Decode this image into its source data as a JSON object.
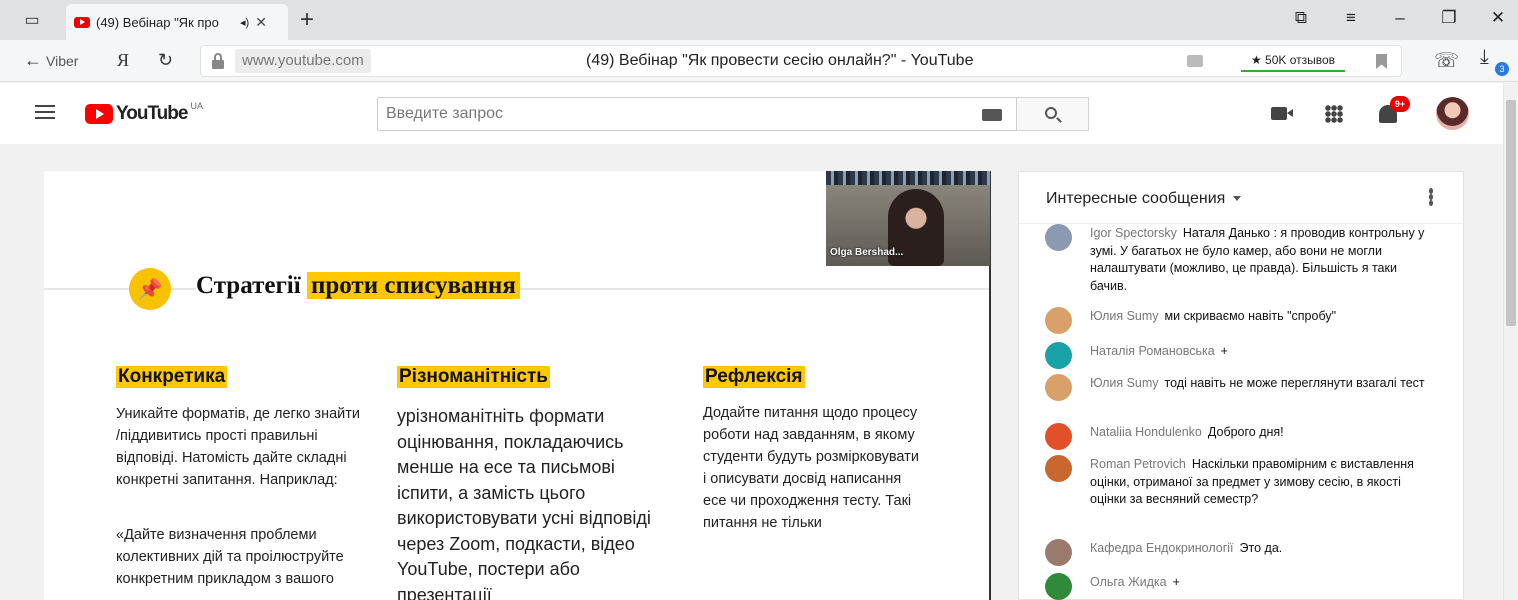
{
  "browser": {
    "tab_title": "(49) Вебінар \"Як про",
    "audio_icon": "speaker-icon",
    "new_tab": "+",
    "back_label": "Viber",
    "yandex_label": "Я",
    "url_domain": "www.youtube.com",
    "page_title": "(49) Вебінар \"Як провести сесію онлайн?\" - YouTube",
    "reviews_badge": "★ 50K отзывов",
    "download_count": "3"
  },
  "youtube": {
    "logo_text": "YouTube",
    "region": "UA",
    "search_placeholder": "Введите запрос",
    "notifications_badge": "9+"
  },
  "slide": {
    "heading_plain": "Стратегії",
    "heading_highlight": "проти списування",
    "col1": {
      "title": "Конкретика",
      "text": "Уникайте форматів, де легко знайти /піддивитись прості правильні відповіді. Натомість дайте складні конкретні запитання. Наприклад:",
      "quote": "«Дайте визначення проблеми колективних дій та проілюструйте конкретним прикладом з вашого"
    },
    "col2": {
      "title": "Різноманітність",
      "text": "урізноманітніть формати оцінювання, покладаючись менше на есе та письмові іспити, а замість цього використовувати усні відповіді через Zoom, подкасти, відео YouTube, постери або презентації"
    },
    "col3": {
      "title": "Рефлексія",
      "text": "Додайте питання щодо процесу роботи над завданням, в якому студенти будуть розмірковувати і описувати досвід написання есе чи проходження тесту. Такі питання не тільки"
    },
    "webcam_name": "Olga Bershad..."
  },
  "chat": {
    "mode": "Интересные сообщения",
    "messages": [
      {
        "author": "Igor Spectorsky",
        "text": "Наталя Данько : я проводив контрольну у зумі. У багатьох не було камер, або вони не могли налаштувати (можливо, це правда). Більшість я таки бачив.",
        "avatar_color": "#8a9ab0"
      },
      {
        "author": "Юлия Sumy",
        "text": "ми скриваємо навіть \"спробу\"",
        "avatar_color": "#d9a06a"
      },
      {
        "author": "Наталія Романовська",
        "text": "+",
        "avatar_color": "#19a3a8"
      },
      {
        "author": "Юлия Sumy",
        "text": "тоді навіть не може переглянути взагалі тест",
        "avatar_color": "#d9a06a"
      },
      {
        "author": "Nataliia Hondulenko",
        "text": "Доброго дня!",
        "avatar_color": "#e2502a"
      },
      {
        "author": "Roman Petrovich",
        "text": "Наскільки правомірним є виставлення оцінки, отриманої за предмет у зимову сесію, в якості оцінки за весняний семестр?",
        "avatar_color": "#c8682e"
      },
      {
        "author": "Кафедра Ендокринології",
        "text": "Это да.",
        "avatar_color": "#9a7a6a"
      },
      {
        "author": "Ольга Жидка",
        "text": "+",
        "avatar_color": "#2f8a3a"
      }
    ]
  }
}
